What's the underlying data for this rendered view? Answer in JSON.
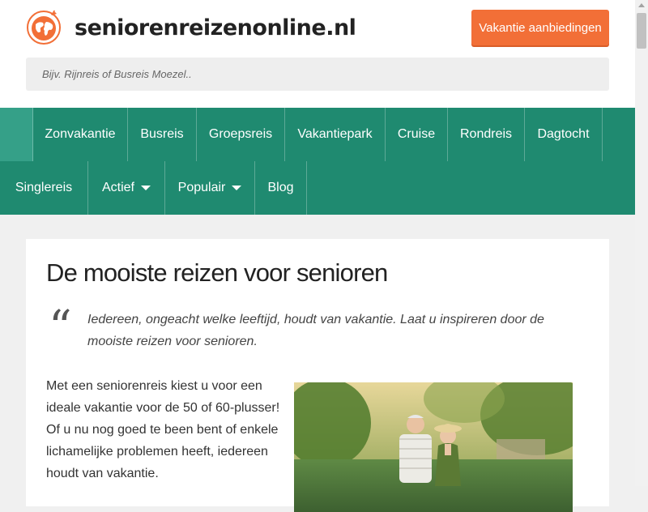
{
  "header": {
    "site_name": "seniorenreizenonline.nl",
    "deals_button": "Vakantie aanbiedingen",
    "search_placeholder": "Bijv. Rijnreis of Busreis Moezel.."
  },
  "nav": {
    "row1": [
      "Zonvakantie",
      "Busreis",
      "Groepsreis",
      "Vakantiepark",
      "Cruise",
      "Rondreis",
      "Dagtocht"
    ],
    "row2": [
      "Singlereis",
      "Actief",
      "Populair",
      "Blog"
    ]
  },
  "main": {
    "title": "De mooiste reizen voor senioren",
    "quote_mark": "“",
    "quote": "Iedereen, ongeacht welke leeftijd, houdt van vakantie. Laat u inspireren door de mooiste reizen voor senioren.",
    "intro": "Met een seniorenreis kiest u voor een ideale vakantie voor de 50 of 60-plusser! Of u nu nog goed te been bent of enkele lichamelijke problemen heeft, iedereen houdt van vakantie."
  },
  "colors": {
    "brand_orange": "#f26f37",
    "nav_green": "#1f8a70",
    "nav_home_active": "#35a088"
  },
  "icons": [
    "globe-plane-logo-icon",
    "caret-down-icon",
    "quote-icon"
  ]
}
